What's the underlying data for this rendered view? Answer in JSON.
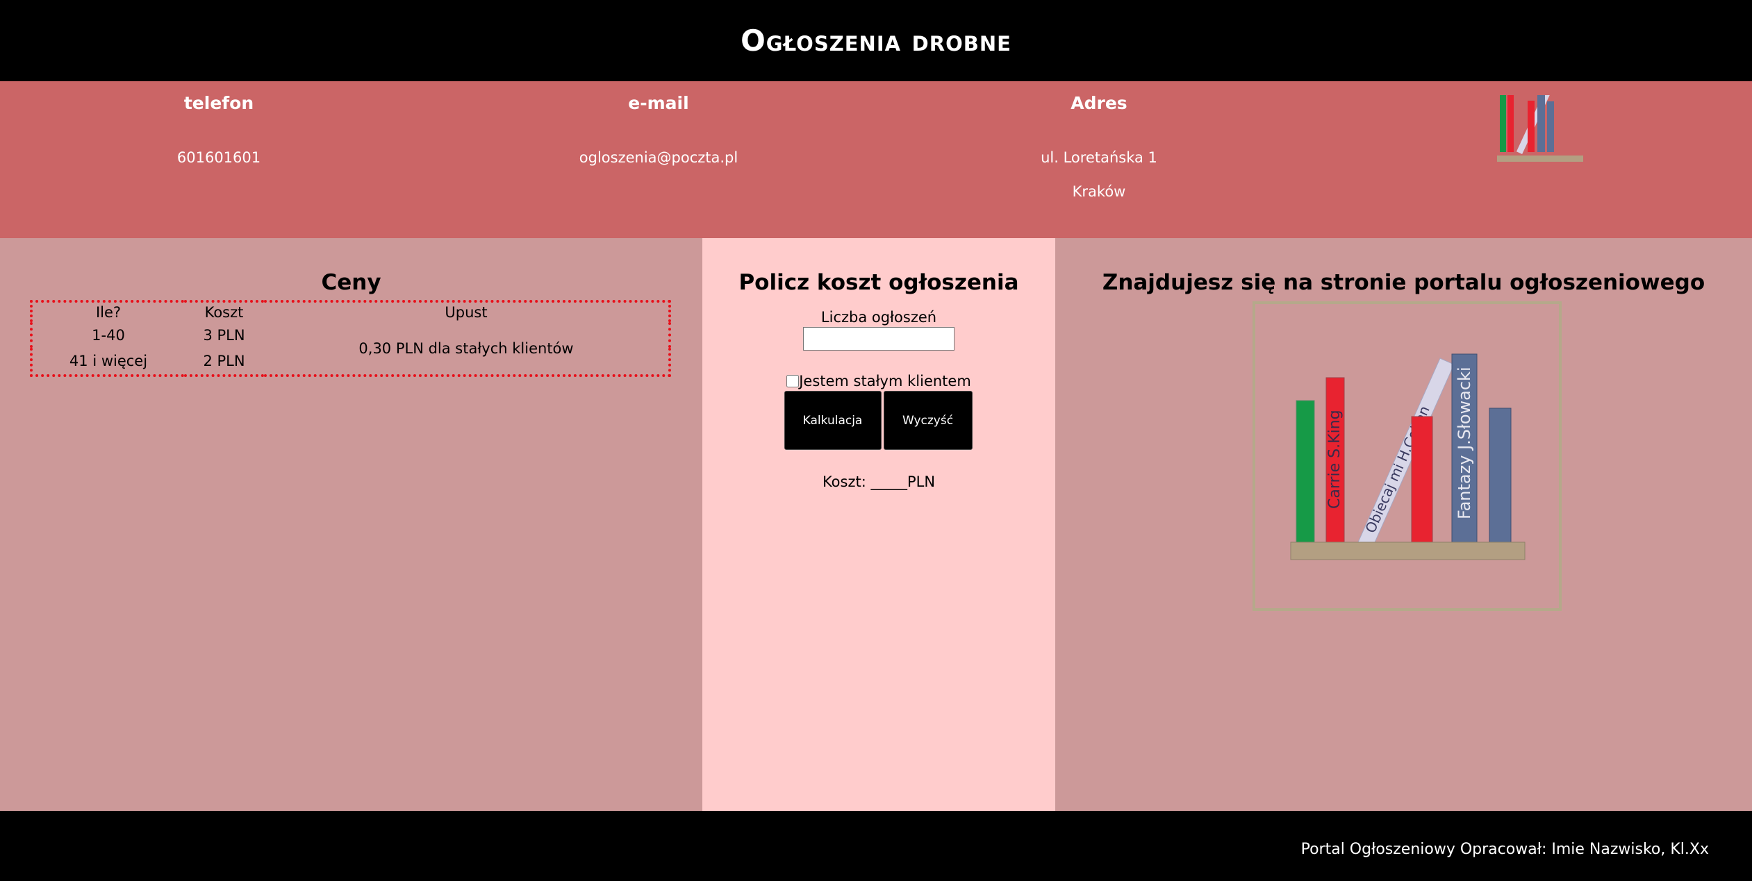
{
  "header": {
    "title": "Ogłoszenia drobne"
  },
  "contact": {
    "phone_label": "telefon",
    "phone_value": "601601601",
    "email_label": "e-mail",
    "email_value": "ogloszenia@poczta.pl",
    "address_label": "Adres",
    "address_line1": "ul. Loretańska 1",
    "address_line2": "Kraków"
  },
  "prices": {
    "title": "Ceny",
    "columns": [
      "Ile?",
      "Koszt",
      "Upust"
    ],
    "rows": [
      {
        "qty": "1-40",
        "cost": "3 PLN"
      },
      {
        "qty": "41 i więcej",
        "cost": "2 PLN"
      }
    ],
    "discount": "0,30 PLN dla stałych klientów"
  },
  "calculator": {
    "title": "Policz koszt ogłoszenia",
    "count_label": "Liczba ogłoszeń",
    "count_value": "",
    "loyal_label": "Jestem stałym klientem",
    "calc_button": "Kalkulacja",
    "clear_button": "Wyczyść",
    "cost_text": "Koszt: _____PLN"
  },
  "info": {
    "title": "Znajdujesz się na stronie portalu ogłoszeniowego",
    "books": [
      "Carrie S.King",
      "Obiecaj mi H.Coben",
      "Fantazy J.Słowacki"
    ]
  },
  "footer": {
    "text": "Portal Ogłoszeniowy Opracował: Imie Nazwisko, Kl.Xx"
  },
  "colors": {
    "banner_bg": "#000000",
    "contact_bg": "#cb6566",
    "side_bg": "#cc9999",
    "middle_bg": "#ffcccc",
    "table_border": "#e8101a"
  }
}
